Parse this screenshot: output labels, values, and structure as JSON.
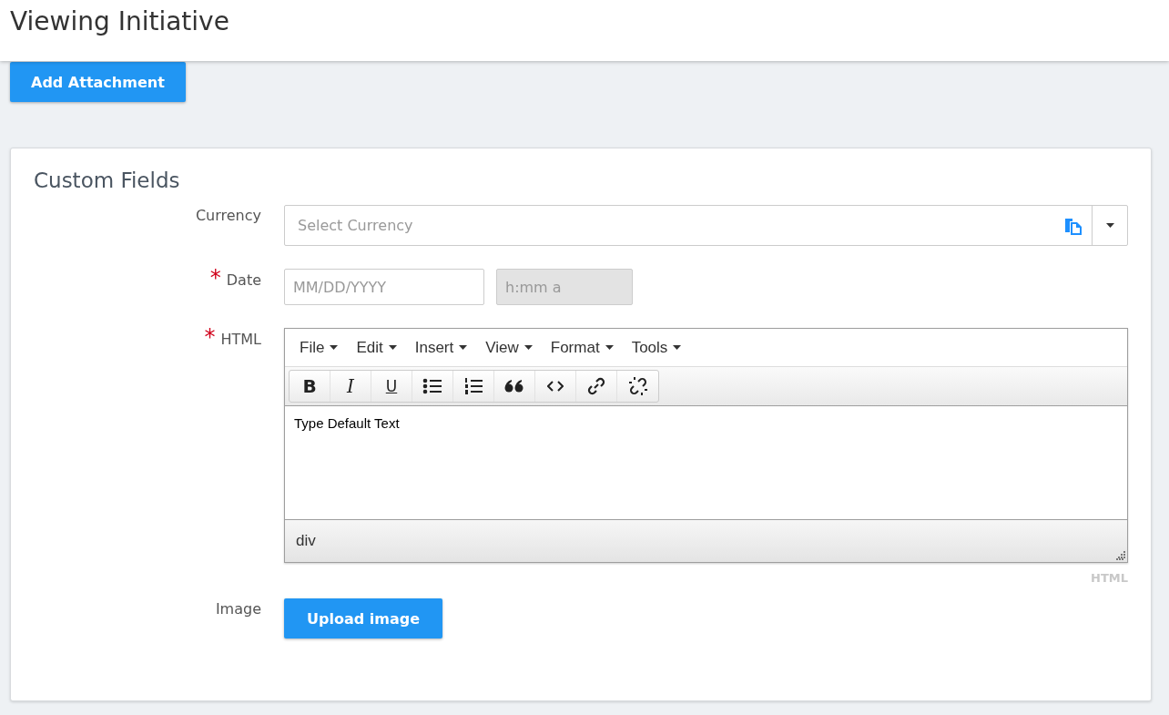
{
  "page_title": "Viewing Initiative",
  "add_attachment": {
    "label": "Add Attachment"
  },
  "card": {
    "title": "Custom Fields",
    "fields": [
      {
        "kind": "select",
        "label": "Currency",
        "placeholder": "Select Currency"
      },
      {
        "kind": "datetime",
        "label": "Date",
        "required_mark": "*",
        "date_placeholder": "MM/DD/YYYY",
        "time_placeholder": "h:mm a",
        "time_disabled": true
      },
      {
        "kind": "editor",
        "label": "HTML",
        "required_mark": "*",
        "menus": [
          {
            "label": "File"
          },
          {
            "label": "Edit"
          },
          {
            "label": "Insert"
          },
          {
            "label": "View"
          },
          {
            "label": "Format"
          },
          {
            "label": "Tools"
          }
        ],
        "toolbar": [
          {
            "kind": "bold",
            "label": "B"
          },
          {
            "kind": "italic",
            "label": "I"
          },
          {
            "kind": "underline",
            "label": "U"
          },
          {
            "kind": "bullets"
          },
          {
            "kind": "numbers"
          },
          {
            "kind": "quote"
          },
          {
            "kind": "code"
          },
          {
            "kind": "link"
          },
          {
            "kind": "unlink"
          }
        ],
        "content": "Type Default Text",
        "path": "div",
        "caption": "HTML"
      },
      {
        "kind": "upload",
        "label": "Image",
        "button": "Upload image"
      }
    ]
  }
}
